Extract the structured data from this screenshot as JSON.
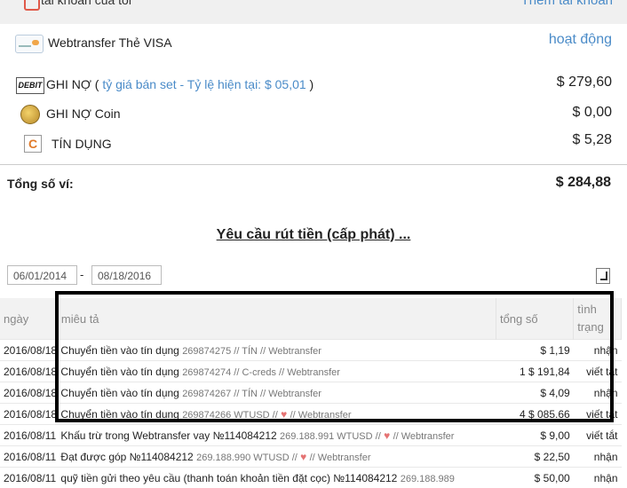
{
  "top": {
    "account_label": "tài khoản của tôi",
    "add_account": "Thêm tài khoản"
  },
  "card": {
    "name": "Webtransfer Thẻ VISA",
    "status": "hoạt động"
  },
  "wallets": [
    {
      "icon": "debit-card-icon",
      "icon_text": "DEBIT",
      "label": "GHI NỢ ( ",
      "link": "tỷ giá bán set - Tỷ lệ hiện tại: $ 05,01",
      "suffix": " )",
      "amount": "$ 279,60"
    },
    {
      "icon": "coin-icon",
      "label": "GHI NỢ Coin",
      "amount": "$ 0,00"
    },
    {
      "icon": "credit-icon",
      "icon_text": "C",
      "label": "TÍN DỤNG",
      "amount": "$ 5,28"
    }
  ],
  "total": {
    "label": "Tổng số ví:",
    "amount": "$ 284,88"
  },
  "section_title": "Yêu cầu rút tiền (cấp phát) ...",
  "dates": {
    "from": "06/01/2014",
    "dash": "-",
    "to": "08/18/2016"
  },
  "table": {
    "headers": [
      "ngày",
      "miêu tả",
      "tổng số",
      "tình trạng"
    ],
    "rows": [
      {
        "date": "2016/08/18",
        "main": "Chuyển tiền vào tín dụng",
        "sub": "269874275 // TÍN // Webtransfer",
        "heart": false,
        "amount": "$ 1,19",
        "status": "nhận"
      },
      {
        "date": "2016/08/18",
        "main": "Chuyển tiền vào tín dụng",
        "sub": "269874274 // C-creds // Webtransfer",
        "heart": false,
        "amount": "1 $ 191,84",
        "status": "viết tắt"
      },
      {
        "date": "2016/08/18",
        "main": "Chuyển tiền vào tín dụng",
        "sub": "269874267 // TÍN // Webtransfer",
        "heart": false,
        "amount": "$ 4,09",
        "status": "nhận"
      },
      {
        "date": "2016/08/18",
        "main": "Chuyển tiền vào tín dụng",
        "sub_pre": "269874266 WTUSD //",
        "sub_post": "// Webtransfer",
        "heart": true,
        "amount": "4 $ 085.66",
        "status": "viết tắt"
      },
      {
        "date": "2016/08/11",
        "main": "Khấu trừ trong Webtransfer vay №114084212",
        "sub_pre": "269.188.991 WTUSD //",
        "sub_post": "// Webtransfer",
        "heart": true,
        "amount": "$ 9,00",
        "status": "viết tắt"
      },
      {
        "date": "2016/08/11",
        "main": "Đạt được góp №114084212",
        "sub_pre": "269.188.990 WTUSD //",
        "sub_post": "// Webtransfer",
        "heart": true,
        "amount": "$ 22,50",
        "status": "nhận"
      },
      {
        "date": "2016/08/11",
        "main": "quỹ tiền gửi theo yêu cầu (thanh toán khoản tiền đặt cọc) №114084212",
        "sub": "269.188.989",
        "heart": false,
        "amount": "$ 50,00",
        "status": "nhận"
      }
    ]
  },
  "colors": {
    "link": "#4a8bc8",
    "header_bg": "#f2f2f2",
    "highlight_border": "#000000",
    "heart": "#e57373"
  }
}
